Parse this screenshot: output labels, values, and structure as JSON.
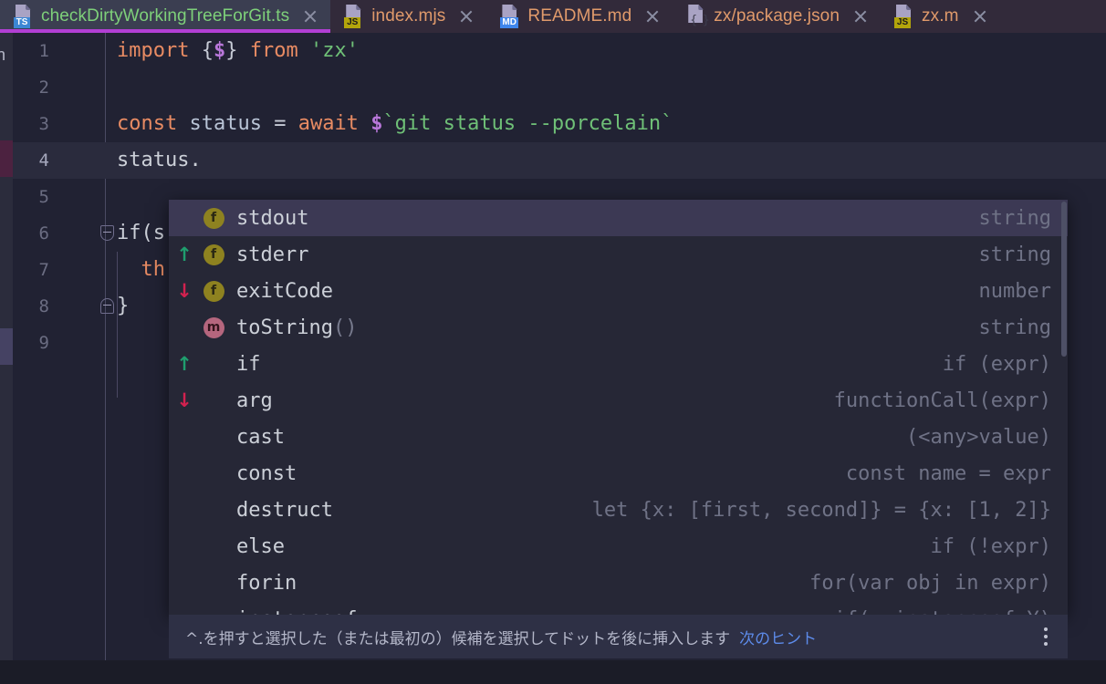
{
  "window": {
    "theme_accent": "#b23fd4",
    "editor_background": "#212233",
    "popup_background": "#262736",
    "selected_row_background": "#3c3954"
  },
  "tabs": [
    {
      "label": "checkDirtyWorkingTreeForGit.ts",
      "icon": "typescript-file-icon",
      "badge": "TS",
      "badge_kind": "ts",
      "active": true,
      "close_icon": "close-icon"
    },
    {
      "label": "index.mjs",
      "icon": "javascript-file-icon",
      "badge": "JS",
      "badge_kind": "js",
      "active": false,
      "close_icon": "close-icon"
    },
    {
      "label": "README.md",
      "icon": "markdown-file-icon",
      "badge": "MD",
      "badge_kind": "md",
      "active": false,
      "close_icon": "close-icon"
    },
    {
      "label": "zx/package.json",
      "icon": "json-file-icon",
      "badge": "{}",
      "badge_kind": "json",
      "active": false,
      "close_icon": "close-icon"
    },
    {
      "label": "zx.m",
      "icon": "javascript-file-icon",
      "badge": "JS",
      "badge_kind": "js",
      "active": false,
      "close_icon": "close-icon"
    }
  ],
  "left_strip": {
    "partial_text": "n",
    "error_marker_color": "#4c2240",
    "selection_marker_color": "#454263"
  },
  "editor": {
    "lines": [
      {
        "number": "1",
        "current": false,
        "tokens": [
          {
            "text": "import ",
            "cls": "kw"
          },
          {
            "text": "{",
            "cls": "punc"
          },
          {
            "text": "$",
            "cls": "dollar"
          },
          {
            "text": "} ",
            "cls": "punc"
          },
          {
            "text": "from ",
            "cls": "kw"
          },
          {
            "text": "'zx'",
            "cls": "str"
          }
        ]
      },
      {
        "number": "2",
        "current": false,
        "tokens": []
      },
      {
        "number": "3",
        "current": false,
        "tokens": [
          {
            "text": "const ",
            "cls": "kw"
          },
          {
            "text": "status ",
            "cls": "var"
          },
          {
            "text": "= ",
            "cls": "punc"
          },
          {
            "text": "await ",
            "cls": "kw"
          },
          {
            "text": "$",
            "cls": "dollar"
          },
          {
            "text": "`git status --porcelain`",
            "cls": "str"
          }
        ]
      },
      {
        "number": "4",
        "current": true,
        "tokens": [
          {
            "text": "status.",
            "cls": "plain"
          }
        ]
      },
      {
        "number": "5",
        "current": false,
        "tokens": []
      },
      {
        "number": "6",
        "current": false,
        "fold": "top",
        "tokens": [
          {
            "text": "if(s",
            "cls": "plain"
          }
        ]
      },
      {
        "number": "7",
        "current": false,
        "tokens": [
          {
            "text": "  th",
            "cls": "kw"
          }
        ]
      },
      {
        "number": "8",
        "current": false,
        "fold": "bot",
        "tokens": [
          {
            "text": "}",
            "cls": "plain"
          }
        ]
      },
      {
        "number": "9",
        "current": false,
        "tokens": []
      }
    ]
  },
  "completion": {
    "items": [
      {
        "move": "",
        "kind": "f",
        "name": "stdout",
        "parens": "",
        "tail": "string",
        "selected": true
      },
      {
        "move": "up",
        "kind": "f",
        "name": "stderr",
        "parens": "",
        "tail": "string",
        "selected": false
      },
      {
        "move": "down",
        "kind": "f",
        "name": "exitCode",
        "parens": "",
        "tail": "number",
        "selected": false
      },
      {
        "move": "",
        "kind": "m",
        "name": "toString",
        "parens": "()",
        "tail": "string",
        "selected": false
      },
      {
        "move": "up",
        "kind": "none",
        "name": "if",
        "parens": "",
        "tail": "if (expr)",
        "selected": false
      },
      {
        "move": "down",
        "kind": "none",
        "name": "arg",
        "parens": "",
        "tail": "functionCall(expr)",
        "selected": false
      },
      {
        "move": "",
        "kind": "none",
        "name": "cast",
        "parens": "",
        "tail": "(<any>value)",
        "selected": false
      },
      {
        "move": "",
        "kind": "none",
        "name": "const",
        "parens": "",
        "tail": "const name = expr",
        "selected": false
      },
      {
        "move": "",
        "kind": "none",
        "name": "destruct",
        "parens": "",
        "tail": "let {x: [first, second]} = {x: [1, 2]}",
        "selected": false
      },
      {
        "move": "",
        "kind": "none",
        "name": "else",
        "parens": "",
        "tail": "if (!expr)",
        "selected": false
      },
      {
        "move": "",
        "kind": "none",
        "name": "forin",
        "parens": "",
        "tail": "for(var obj in expr)",
        "selected": false
      },
      {
        "move": "",
        "kind": "none",
        "name": "instanceof",
        "parens": "",
        "tail": "if(x instanceof Y)",
        "selected": false
      }
    ]
  },
  "hint": {
    "text": "^.を押すと選択した（または最初の）候補を選択してドットを後に挿入します",
    "link_label": "次のヒント",
    "menu_icon": "kebab-menu-icon"
  }
}
